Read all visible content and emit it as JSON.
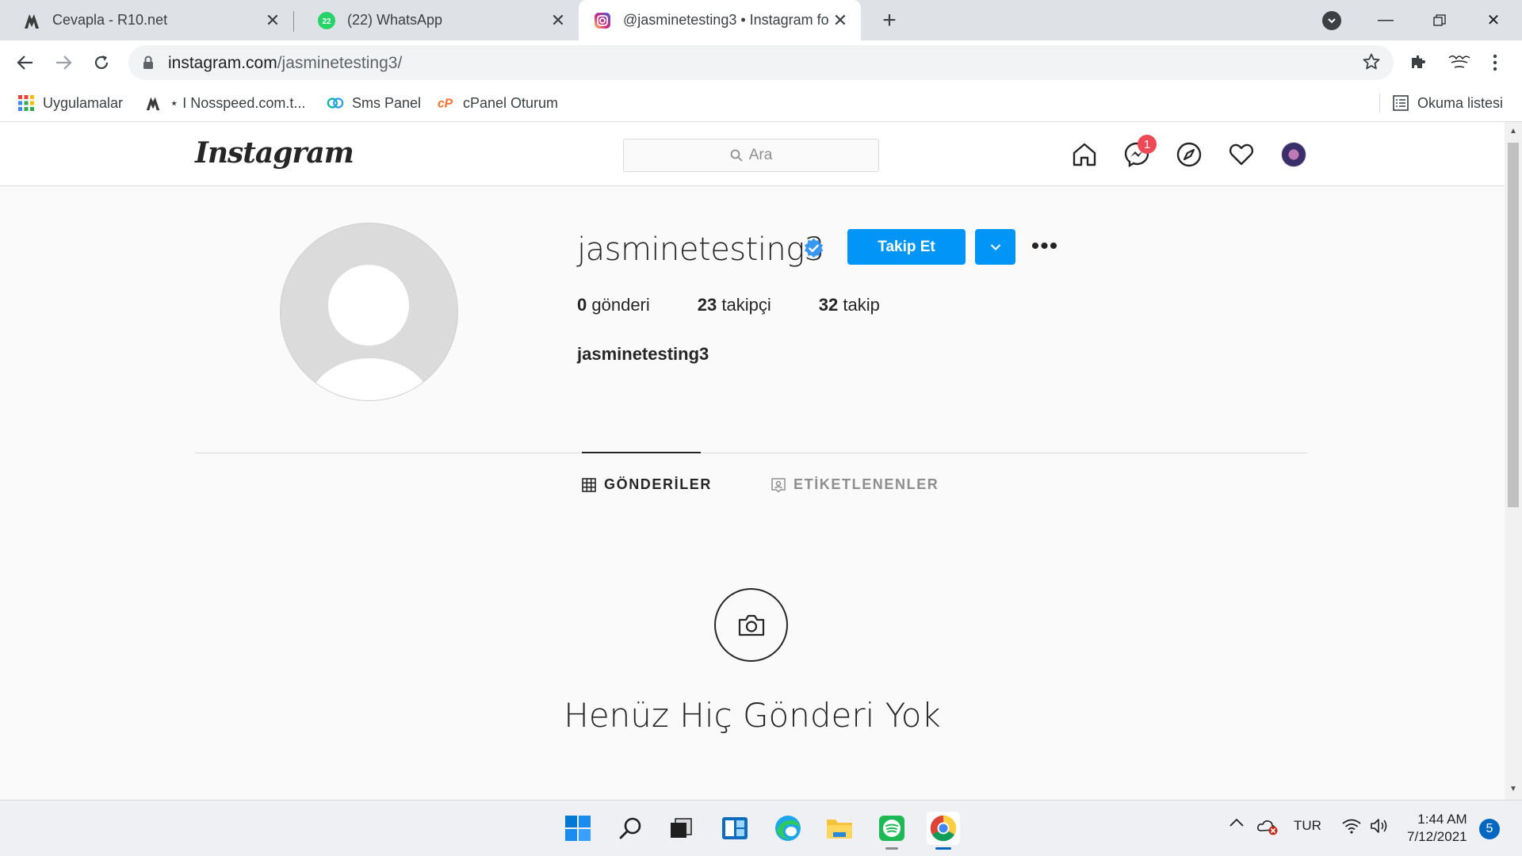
{
  "browser": {
    "tabs": [
      {
        "title": "Cevapla - R10.net",
        "icon": "r10-icon"
      },
      {
        "title": "(22) WhatsApp",
        "icon": "whatsapp-icon",
        "badge": "22"
      },
      {
        "title": "@jasminetesting3 • Instagram fo",
        "icon": "instagram-icon",
        "active": true
      }
    ],
    "url_domain": "instagram.com",
    "url_path": "/jasminetesting3/",
    "bookmarks": [
      {
        "label": "Uygulamalar",
        "icon": "apps-grid-icon"
      },
      {
        "label": "⋆ I Nosspeed.com.t...",
        "icon": "r10-icon"
      },
      {
        "label": "Sms Panel",
        "icon": "sms-panel-icon"
      },
      {
        "label": "cPanel Oturum",
        "icon": "cpanel-icon"
      }
    ],
    "reading_list": "Okuma listesi"
  },
  "instagram": {
    "logo": "Instagram",
    "search_placeholder": "Ara",
    "messages_badge": "1",
    "username": "jasminetesting3",
    "follow_label": "Takip Et",
    "more_label": "•••",
    "stats": {
      "posts_count": "0",
      "posts_label": "gönderi",
      "followers_count": "23",
      "followers_label": "takipçi",
      "following_count": "32",
      "following_label": "takip"
    },
    "full_name": "jasminetesting3",
    "tabs": [
      {
        "label": "GÖNDERİLER",
        "active": true
      },
      {
        "label": "ETİKETLENENLER",
        "active": false
      }
    ],
    "empty_message": "Henüz Hiç Gönderi Yok",
    "colors": {
      "primary_button": "#0095f6",
      "badge": "#ed4956",
      "verified": "#3897f0"
    }
  },
  "taskbar": {
    "language": "TUR",
    "time": "1:44 AM",
    "date": "7/12/2021",
    "notifications": "5"
  }
}
